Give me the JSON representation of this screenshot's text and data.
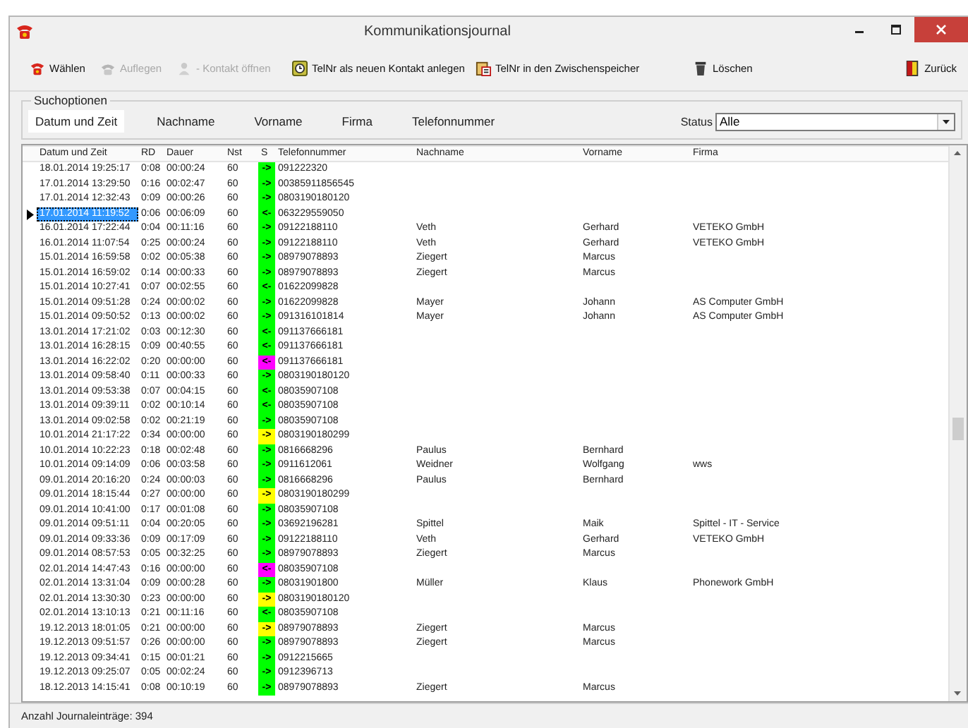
{
  "window": {
    "title": "Kommunikationsjournal"
  },
  "toolbar": [
    {
      "kind": "dial",
      "label": "Wählen",
      "disabled": false
    },
    {
      "kind": "hangup",
      "label": "Auflegen",
      "disabled": true
    },
    {
      "kind": "contact",
      "label": "- Kontakt öffnen",
      "disabled": true
    },
    {
      "kind": "newcontact",
      "label": "TelNr als neuen Kontakt anlegen",
      "disabled": false
    },
    {
      "kind": "clipboard",
      "label": "TelNr in den Zwischenspeicher",
      "disabled": false
    },
    {
      "kind": "delete",
      "label": "Löschen",
      "disabled": false
    },
    {
      "kind": "back",
      "label": "Zurück",
      "disabled": false
    }
  ],
  "search": {
    "title": "Suchoptionen",
    "tabs": [
      {
        "label": "Datum und Zeit",
        "selected": true
      },
      {
        "label": "Nachname",
        "selected": false
      },
      {
        "label": "Vorname",
        "selected": false
      },
      {
        "label": "Firma",
        "selected": false
      },
      {
        "label": "Telefonnummer",
        "selected": false
      }
    ],
    "status_label": "Status",
    "status_value": "Alle"
  },
  "table": {
    "columns": [
      "Datum und Zeit",
      "RD",
      "Dauer",
      "Nst",
      "S",
      "Telefonnummer",
      "Nachname",
      "Vorname",
      "Firma"
    ],
    "rows": [
      {
        "datum": "18.01.2014 19:25:17",
        "rd": "0:08",
        "dauer": "00:00:24",
        "nst": "60",
        "s": "->",
        "color": "#00ff00",
        "tel": "091222320",
        "selected": false
      },
      {
        "datum": "17.01.2014 13:29:50",
        "rd": "0:16",
        "dauer": "00:02:47",
        "nst": "60",
        "s": "->",
        "color": "#00ff00",
        "tel": "00385911856545",
        "selected": false
      },
      {
        "datum": "17.01.2014 12:32:43",
        "rd": "0:09",
        "dauer": "00:00:26",
        "nst": "60",
        "s": "->",
        "color": "#00ff00",
        "tel": "0803190180120",
        "selected": false
      },
      {
        "datum": "17.01.2014 11:19:52",
        "rd": "0:06",
        "dauer": "00:06:09",
        "nst": "60",
        "s": "<-",
        "color": "#00ff00",
        "tel": "063229559050",
        "selected": true
      },
      {
        "datum": "16.01.2014 17:22:44",
        "rd": "0:04",
        "dauer": "00:11:16",
        "nst": "60",
        "s": "->",
        "color": "#00ff00",
        "tel": "09122188110",
        "nachname": "Veth",
        "vorname": "Gerhard",
        "firma": "VETEKO GmbH",
        "selected": false
      },
      {
        "datum": "16.01.2014 11:07:54",
        "rd": "0:25",
        "dauer": "00:00:24",
        "nst": "60",
        "s": "->",
        "color": "#00ff00",
        "tel": "09122188110",
        "nachname": "Veth",
        "vorname": "Gerhard",
        "firma": "VETEKO GmbH",
        "selected": false
      },
      {
        "datum": "15.01.2014 16:59:58",
        "rd": "0:02",
        "dauer": "00:05:38",
        "nst": "60",
        "s": "->",
        "color": "#00ff00",
        "tel": "08979078893",
        "nachname": "Ziegert",
        "vorname": "Marcus",
        "selected": false
      },
      {
        "datum": "15.01.2014 16:59:02",
        "rd": "0:14",
        "dauer": "00:00:33",
        "nst": "60",
        "s": "->",
        "color": "#00ff00",
        "tel": "08979078893",
        "nachname": "Ziegert",
        "vorname": "Marcus",
        "selected": false
      },
      {
        "datum": "15.01.2014 10:27:41",
        "rd": "0:07",
        "dauer": "00:02:55",
        "nst": "60",
        "s": "<-",
        "color": "#00ff00",
        "tel": "01622099828",
        "selected": false
      },
      {
        "datum": "15.01.2014 09:51:28",
        "rd": "0:24",
        "dauer": "00:00:02",
        "nst": "60",
        "s": "->",
        "color": "#00ff00",
        "tel": "01622099828",
        "nachname": "Mayer",
        "vorname": "Johann",
        "firma": "AS Computer GmbH",
        "selected": false
      },
      {
        "datum": "15.01.2014 09:50:52",
        "rd": "0:13",
        "dauer": "00:00:02",
        "nst": "60",
        "s": "->",
        "color": "#00ff00",
        "tel": "091316101814",
        "nachname": "Mayer",
        "vorname": "Johann",
        "firma": "AS Computer GmbH",
        "selected": false
      },
      {
        "datum": "13.01.2014 17:21:02",
        "rd": "0:03",
        "dauer": "00:12:30",
        "nst": "60",
        "s": "<-",
        "color": "#00ff00",
        "tel": "091137666181",
        "selected": false
      },
      {
        "datum": "13.01.2014 16:28:15",
        "rd": "0:09",
        "dauer": "00:40:55",
        "nst": "60",
        "s": "<-",
        "color": "#00ff00",
        "tel": "091137666181",
        "selected": false
      },
      {
        "datum": "13.01.2014 16:22:02",
        "rd": "0:20",
        "dauer": "00:00:00",
        "nst": "60",
        "s": "<-",
        "color": "#ff00ff",
        "tel": "091137666181",
        "selected": false
      },
      {
        "datum": "13.01.2014 09:58:40",
        "rd": "0:11",
        "dauer": "00:00:33",
        "nst": "60",
        "s": "->",
        "color": "#00ff00",
        "tel": "0803190180120",
        "selected": false
      },
      {
        "datum": "13.01.2014 09:53:38",
        "rd": "0:07",
        "dauer": "00:04:15",
        "nst": "60",
        "s": "<-",
        "color": "#00ff00",
        "tel": "08035907108",
        "selected": false
      },
      {
        "datum": "13.01.2014 09:39:11",
        "rd": "0:02",
        "dauer": "00:10:14",
        "nst": "60",
        "s": "<-",
        "color": "#00ff00",
        "tel": "08035907108",
        "selected": false
      },
      {
        "datum": "13.01.2014 09:02:58",
        "rd": "0:02",
        "dauer": "00:21:19",
        "nst": "60",
        "s": "->",
        "color": "#00ff00",
        "tel": "08035907108",
        "selected": false
      },
      {
        "datum": "10.01.2014 21:17:22",
        "rd": "0:34",
        "dauer": "00:00:00",
        "nst": "60",
        "s": "->",
        "color": "#ffff00",
        "tel": "0803190180299",
        "selected": false
      },
      {
        "datum": "10.01.2014 10:22:23",
        "rd": "0:18",
        "dauer": "00:02:48",
        "nst": "60",
        "s": "->",
        "color": "#00ff00",
        "tel": "0816668296",
        "nachname": "Paulus",
        "vorname": "Bernhard",
        "selected": false
      },
      {
        "datum": "10.01.2014 09:14:09",
        "rd": "0:06",
        "dauer": "00:03:58",
        "nst": "60",
        "s": "->",
        "color": "#00ff00",
        "tel": "0911612061",
        "nachname": "Weidner",
        "vorname": "Wolfgang",
        "firma": "wws",
        "selected": false
      },
      {
        "datum": "09.01.2014 20:16:20",
        "rd": "0:24",
        "dauer": "00:00:03",
        "nst": "60",
        "s": "->",
        "color": "#00ff00",
        "tel": "0816668296",
        "nachname": "Paulus",
        "vorname": "Bernhard",
        "selected": false
      },
      {
        "datum": "09.01.2014 18:15:44",
        "rd": "0:27",
        "dauer": "00:00:00",
        "nst": "60",
        "s": "->",
        "color": "#ffff00",
        "tel": "0803190180299",
        "selected": false
      },
      {
        "datum": "09.01.2014 10:41:00",
        "rd": "0:17",
        "dauer": "00:01:08",
        "nst": "60",
        "s": "->",
        "color": "#00ff00",
        "tel": "08035907108",
        "selected": false
      },
      {
        "datum": "09.01.2014 09:51:11",
        "rd": "0:04",
        "dauer": "00:20:05",
        "nst": "60",
        "s": "->",
        "color": "#00ff00",
        "tel": "03692196281",
        "nachname": "Spittel",
        "vorname": "Maik",
        "firma": "Spittel - IT - Service",
        "selected": false
      },
      {
        "datum": "09.01.2014 09:33:36",
        "rd": "0:09",
        "dauer": "00:17:09",
        "nst": "60",
        "s": "->",
        "color": "#00ff00",
        "tel": "09122188110",
        "nachname": "Veth",
        "vorname": "Gerhard",
        "firma": "VETEKO GmbH",
        "selected": false
      },
      {
        "datum": "09.01.2014 08:57:53",
        "rd": "0:05",
        "dauer": "00:32:25",
        "nst": "60",
        "s": "->",
        "color": "#00ff00",
        "tel": "08979078893",
        "nachname": "Ziegert",
        "vorname": "Marcus",
        "selected": false
      },
      {
        "datum": "02.01.2014 14:47:43",
        "rd": "0:16",
        "dauer": "00:00:00",
        "nst": "60",
        "s": "<-",
        "color": "#ff00ff",
        "tel": "08035907108",
        "selected": false
      },
      {
        "datum": "02.01.2014 13:31:04",
        "rd": "0:09",
        "dauer": "00:00:28",
        "nst": "60",
        "s": "->",
        "color": "#00ff00",
        "tel": "08031901800",
        "nachname": "Müller",
        "vorname": "Klaus",
        "firma": "Phonework GmbH",
        "selected": false
      },
      {
        "datum": "02.01.2014 13:30:30",
        "rd": "0:23",
        "dauer": "00:00:00",
        "nst": "60",
        "s": "->",
        "color": "#ffff00",
        "tel": "0803190180120",
        "selected": false
      },
      {
        "datum": "02.01.2014 13:10:13",
        "rd": "0:21",
        "dauer": "00:11:16",
        "nst": "60",
        "s": "<-",
        "color": "#00ff00",
        "tel": "08035907108",
        "selected": false
      },
      {
        "datum": "19.12.2013 18:01:05",
        "rd": "0:21",
        "dauer": "00:00:00",
        "nst": "60",
        "s": "->",
        "color": "#ffff00",
        "tel": "08979078893",
        "nachname": "Ziegert",
        "vorname": "Marcus",
        "selected": false
      },
      {
        "datum": "19.12.2013 09:51:57",
        "rd": "0:26",
        "dauer": "00:00:00",
        "nst": "60",
        "s": "->",
        "color": "#00ff00",
        "tel": "08979078893",
        "nachname": "Ziegert",
        "vorname": "Marcus",
        "selected": false
      },
      {
        "datum": "19.12.2013 09:34:41",
        "rd": "0:15",
        "dauer": "00:01:21",
        "nst": "60",
        "s": "->",
        "color": "#00ff00",
        "tel": "0912215665",
        "selected": false
      },
      {
        "datum": "19.12.2013 09:25:07",
        "rd": "0:05",
        "dauer": "00:02:24",
        "nst": "60",
        "s": "->",
        "color": "#00ff00",
        "tel": "0912396713",
        "selected": false
      },
      {
        "datum": "18.12.2013 14:15:41",
        "rd": "0:08",
        "dauer": "00:10:19",
        "nst": "60",
        "s": "->",
        "color": "#00ff00",
        "tel": "08979078893",
        "nachname": "Ziegert",
        "vorname": "Marcus",
        "selected": false
      }
    ]
  },
  "status_bar": "Anzahl Journaleinträge: 394"
}
